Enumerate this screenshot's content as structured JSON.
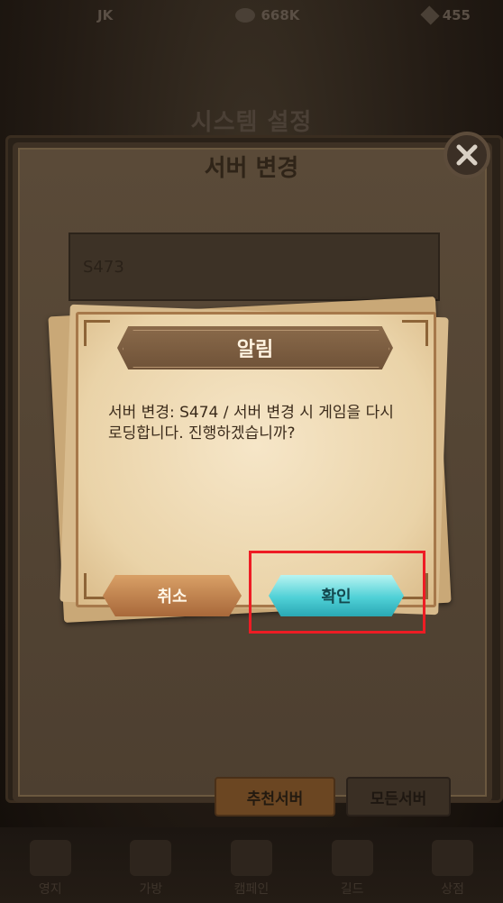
{
  "hud": {
    "player": "JK",
    "gold": "668K",
    "gems": "455"
  },
  "system": {
    "title": "시스템 설정"
  },
  "server_panel": {
    "title": "서버 변경",
    "current_server": "S473",
    "tabs": [
      "추천서버",
      "모든서버"
    ],
    "side_labels": [
      "...",
      "..."
    ]
  },
  "alert": {
    "title": "알림",
    "message": "서버 변경: S474 / 서버 변경 시 게임을 다시 로딩합니다. 진행하겠습니까?",
    "cancel_label": "취소",
    "confirm_label": "확인"
  },
  "bottom_nav": [
    "영지",
    "가방",
    "캠페인",
    "길드",
    "상점"
  ],
  "colors": {
    "highlight": "#ee1c24",
    "confirm_button": "#4fd0d6",
    "cancel_button": "#c0814e"
  }
}
